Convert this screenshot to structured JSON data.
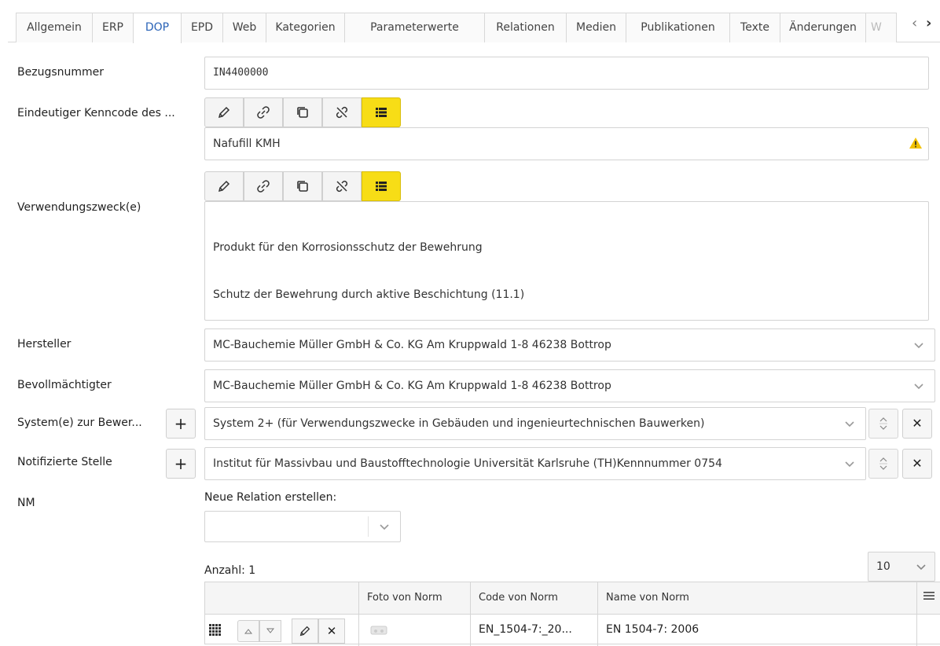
{
  "tabs": [
    "Allgemein",
    "ERP",
    "DOP",
    "EPD",
    "Web",
    "Kategorien",
    "Parameterwerte",
    "Relationen",
    "Medien",
    "Publikationen",
    "Texte",
    "Änderungen",
    "W"
  ],
  "active_tab": "DOP",
  "fields": {
    "bezugsnummer": {
      "label": "Bezugsnummer",
      "value": "IN4400000"
    },
    "kenncode": {
      "label": "Eindeutiger Kenncode des ...",
      "value": "Nafufill KMH"
    },
    "verwendungszweck": {
      "label": "Verwendungszweck(e)",
      "line1": "Produkt für den Korrosionsschutz der Bewehrung",
      "line2": "Schutz der Bewehrung durch aktive Beschichtung (11.1)"
    },
    "hersteller": {
      "label": "Hersteller",
      "value": "MC-Bauchemie Müller GmbH & Co. KG Am Kruppwald 1-8 46238 Bottrop"
    },
    "bevollmaechtigter": {
      "label": "Bevollmächtigter",
      "value": "MC-Bauchemie Müller GmbH & Co. KG Am Kruppwald 1-8 46238 Bottrop"
    },
    "systeme": {
      "label": "System(e) zur Bewer...",
      "value": "System 2+ (für Verwendungszwecke in Gebäuden und ingenieurtechnischen Bauwerken)"
    },
    "notifizierte": {
      "label": "Notifizierte Stelle",
      "value": "Institut für Massivbau und Baustofftechnologie Universität Karlsruhe (TH)Kennnummer 0754"
    },
    "nm": {
      "label": "NM"
    }
  },
  "relation": {
    "new_label": "Neue Relation erstellen:",
    "count_label": "Anzahl: 1",
    "page_size": "10"
  },
  "table": {
    "headers": [
      "Foto von Norm",
      "Code von Norm",
      "Name von Norm"
    ],
    "row": {
      "code": "EN_1504-7:_20...",
      "name": "EN 1504-7: 2006"
    }
  },
  "colors": {
    "accent_tab": "#2a63b7",
    "highlight_button": "#f7dd16",
    "warning": "#f2c200"
  }
}
